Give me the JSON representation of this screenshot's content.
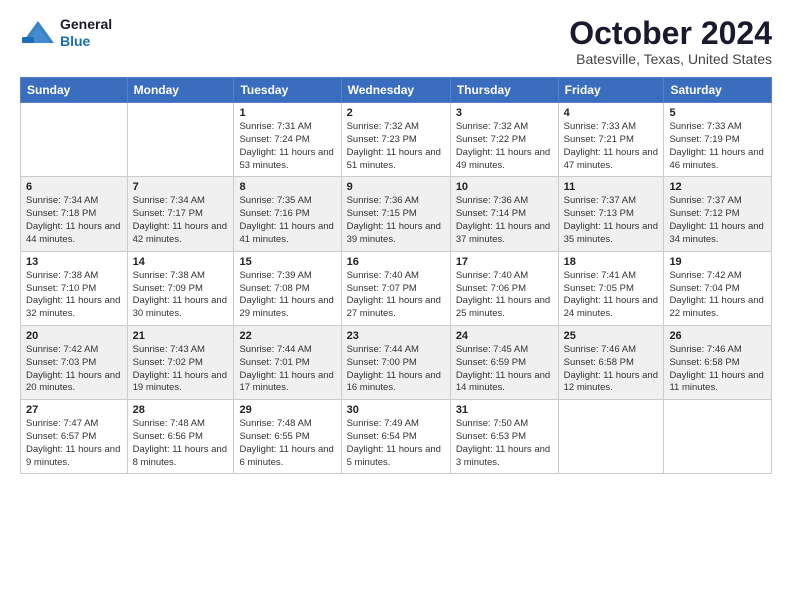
{
  "header": {
    "logo_line1": "General",
    "logo_line2": "Blue",
    "title": "October 2024",
    "subtitle": "Batesville, Texas, United States"
  },
  "weekdays": [
    "Sunday",
    "Monday",
    "Tuesday",
    "Wednesday",
    "Thursday",
    "Friday",
    "Saturday"
  ],
  "weeks": [
    [
      {
        "day": "",
        "info": ""
      },
      {
        "day": "",
        "info": ""
      },
      {
        "day": "1",
        "info": "Sunrise: 7:31 AM\nSunset: 7:24 PM\nDaylight: 11 hours\nand 53 minutes."
      },
      {
        "day": "2",
        "info": "Sunrise: 7:32 AM\nSunset: 7:23 PM\nDaylight: 11 hours\nand 51 minutes."
      },
      {
        "day": "3",
        "info": "Sunrise: 7:32 AM\nSunset: 7:22 PM\nDaylight: 11 hours\nand 49 minutes."
      },
      {
        "day": "4",
        "info": "Sunrise: 7:33 AM\nSunset: 7:21 PM\nDaylight: 11 hours\nand 47 minutes."
      },
      {
        "day": "5",
        "info": "Sunrise: 7:33 AM\nSunset: 7:19 PM\nDaylight: 11 hours\nand 46 minutes."
      }
    ],
    [
      {
        "day": "6",
        "info": "Sunrise: 7:34 AM\nSunset: 7:18 PM\nDaylight: 11 hours\nand 44 minutes."
      },
      {
        "day": "7",
        "info": "Sunrise: 7:34 AM\nSunset: 7:17 PM\nDaylight: 11 hours\nand 42 minutes."
      },
      {
        "day": "8",
        "info": "Sunrise: 7:35 AM\nSunset: 7:16 PM\nDaylight: 11 hours\nand 41 minutes."
      },
      {
        "day": "9",
        "info": "Sunrise: 7:36 AM\nSunset: 7:15 PM\nDaylight: 11 hours\nand 39 minutes."
      },
      {
        "day": "10",
        "info": "Sunrise: 7:36 AM\nSunset: 7:14 PM\nDaylight: 11 hours\nand 37 minutes."
      },
      {
        "day": "11",
        "info": "Sunrise: 7:37 AM\nSunset: 7:13 PM\nDaylight: 11 hours\nand 35 minutes."
      },
      {
        "day": "12",
        "info": "Sunrise: 7:37 AM\nSunset: 7:12 PM\nDaylight: 11 hours\nand 34 minutes."
      }
    ],
    [
      {
        "day": "13",
        "info": "Sunrise: 7:38 AM\nSunset: 7:10 PM\nDaylight: 11 hours\nand 32 minutes."
      },
      {
        "day": "14",
        "info": "Sunrise: 7:38 AM\nSunset: 7:09 PM\nDaylight: 11 hours\nand 30 minutes."
      },
      {
        "day": "15",
        "info": "Sunrise: 7:39 AM\nSunset: 7:08 PM\nDaylight: 11 hours\nand 29 minutes."
      },
      {
        "day": "16",
        "info": "Sunrise: 7:40 AM\nSunset: 7:07 PM\nDaylight: 11 hours\nand 27 minutes."
      },
      {
        "day": "17",
        "info": "Sunrise: 7:40 AM\nSunset: 7:06 PM\nDaylight: 11 hours\nand 25 minutes."
      },
      {
        "day": "18",
        "info": "Sunrise: 7:41 AM\nSunset: 7:05 PM\nDaylight: 11 hours\nand 24 minutes."
      },
      {
        "day": "19",
        "info": "Sunrise: 7:42 AM\nSunset: 7:04 PM\nDaylight: 11 hours\nand 22 minutes."
      }
    ],
    [
      {
        "day": "20",
        "info": "Sunrise: 7:42 AM\nSunset: 7:03 PM\nDaylight: 11 hours\nand 20 minutes."
      },
      {
        "day": "21",
        "info": "Sunrise: 7:43 AM\nSunset: 7:02 PM\nDaylight: 11 hours\nand 19 minutes."
      },
      {
        "day": "22",
        "info": "Sunrise: 7:44 AM\nSunset: 7:01 PM\nDaylight: 11 hours\nand 17 minutes."
      },
      {
        "day": "23",
        "info": "Sunrise: 7:44 AM\nSunset: 7:00 PM\nDaylight: 11 hours\nand 16 minutes."
      },
      {
        "day": "24",
        "info": "Sunrise: 7:45 AM\nSunset: 6:59 PM\nDaylight: 11 hours\nand 14 minutes."
      },
      {
        "day": "25",
        "info": "Sunrise: 7:46 AM\nSunset: 6:58 PM\nDaylight: 11 hours\nand 12 minutes."
      },
      {
        "day": "26",
        "info": "Sunrise: 7:46 AM\nSunset: 6:58 PM\nDaylight: 11 hours\nand 11 minutes."
      }
    ],
    [
      {
        "day": "27",
        "info": "Sunrise: 7:47 AM\nSunset: 6:57 PM\nDaylight: 11 hours\nand 9 minutes."
      },
      {
        "day": "28",
        "info": "Sunrise: 7:48 AM\nSunset: 6:56 PM\nDaylight: 11 hours\nand 8 minutes."
      },
      {
        "day": "29",
        "info": "Sunrise: 7:48 AM\nSunset: 6:55 PM\nDaylight: 11 hours\nand 6 minutes."
      },
      {
        "day": "30",
        "info": "Sunrise: 7:49 AM\nSunset: 6:54 PM\nDaylight: 11 hours\nand 5 minutes."
      },
      {
        "day": "31",
        "info": "Sunrise: 7:50 AM\nSunset: 6:53 PM\nDaylight: 11 hours\nand 3 minutes."
      },
      {
        "day": "",
        "info": ""
      },
      {
        "day": "",
        "info": ""
      }
    ]
  ]
}
